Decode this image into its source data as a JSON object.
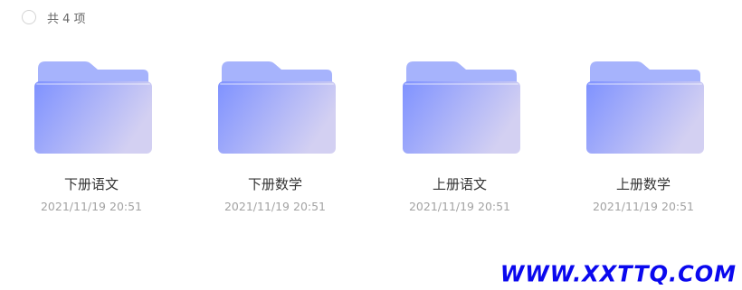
{
  "header": {
    "count_label": "共 4 项"
  },
  "folders": [
    {
      "name": "下册语文",
      "time": "2021/11/19 20:51"
    },
    {
      "name": "下册数学",
      "time": "2021/11/19 20:51"
    },
    {
      "name": "上册语文",
      "time": "2021/11/19 20:51"
    },
    {
      "name": "上册数学",
      "time": "2021/11/19 20:51"
    }
  ],
  "icons": {
    "folder": "folder-icon",
    "select": "select-all-checkbox"
  },
  "colors": {
    "folder_back": "#a6b3fc",
    "folder_front_start": "#7f92ff",
    "folder_front_end": "#cfcdf4",
    "watermark": "#0a08ee"
  },
  "watermark": {
    "text": "WWW.XXTTQ.COM"
  }
}
